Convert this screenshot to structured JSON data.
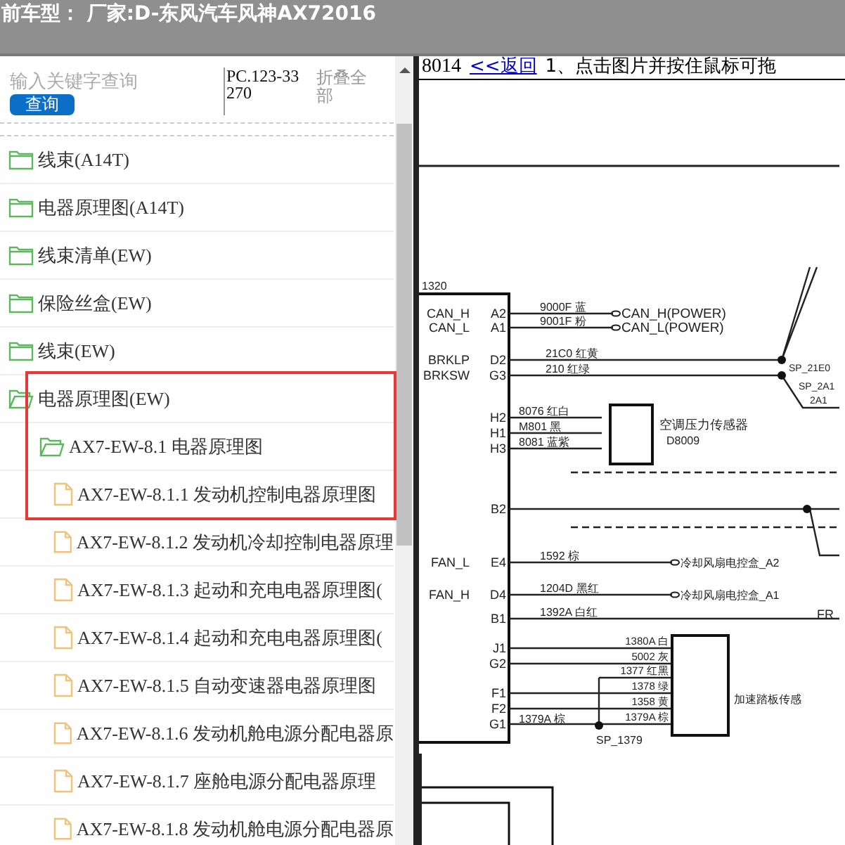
{
  "header": {
    "title": "前车型： 厂家:D-东风汽车风神AX72016"
  },
  "sidebar": {
    "search": {
      "placeholder": "输入关键字查询",
      "button": "查询"
    },
    "code": "PC.123-33270",
    "collapse_all": "折叠全部",
    "items": [
      {
        "kind": "folder",
        "label": "线束(A14T)",
        "expanded": false,
        "highlighted": false
      },
      {
        "kind": "folder",
        "label": "电器原理图(A14T)",
        "expanded": false,
        "highlighted": false
      },
      {
        "kind": "folder",
        "label": "线束清单(EW)",
        "expanded": false,
        "highlighted": false
      },
      {
        "kind": "folder",
        "label": "保险丝盒(EW)",
        "expanded": false,
        "highlighted": false
      },
      {
        "kind": "folder",
        "label": "线束(EW)",
        "expanded": false,
        "highlighted": false
      },
      {
        "kind": "folder",
        "label": "电器原理图(EW)",
        "expanded": true,
        "highlighted": true,
        "children": [
          {
            "kind": "folder",
            "label": "AX7-EW-8.1 电器原理图",
            "expanded": true,
            "highlighted": true,
            "children": [
              {
                "kind": "file",
                "label": "AX7-EW-8.1.1 发动机控制电器原理图",
                "highlighted": true
              },
              {
                "kind": "file",
                "label": "AX7-EW-8.1.2 发动机冷却控制电器原理",
                "highlighted": false
              },
              {
                "kind": "file",
                "label": "AX7-EW-8.1.3 起动和充电电器原理图(",
                "highlighted": false
              },
              {
                "kind": "file",
                "label": "AX7-EW-8.1.4 起动和充电电器原理图(",
                "highlighted": false
              },
              {
                "kind": "file",
                "label": "AX7-EW-8.1.5 自动变速器电器原理图",
                "highlighted": false
              },
              {
                "kind": "file",
                "label": "AX7-EW-8.1.6 发动机舱电源分配电器原",
                "highlighted": false
              },
              {
                "kind": "file",
                "label": "AX7-EW-8.1.7 座舱电源分配电器原理",
                "highlighted": false
              },
              {
                "kind": "file",
                "label": "AX7-EW-8.1.8 发动机舱电源分配电器原",
                "highlighted": false
              }
            ]
          }
        ]
      }
    ]
  },
  "viewer": {
    "page_code": "8014",
    "back_link": "<<返回",
    "hint": "1、点击图片并按住鼠标可拖",
    "diagram": {
      "connector": "1320",
      "pins": [
        {
          "signal": "CAN_H",
          "pin": "A2",
          "wire": "9000F 蓝",
          "target": "CAN_H(POWER)"
        },
        {
          "signal": "CAN_L",
          "pin": "A1",
          "wire": "9001F 粉",
          "target": "CAN_L(POWER)"
        },
        {
          "signal": "BRKLP",
          "pin": "D2",
          "wire": "21C0 红黄"
        },
        {
          "signal": "BRKSW",
          "pin": "G3",
          "wire": "210 红绿"
        },
        {
          "pin": "H2",
          "wire": "8076 红白"
        },
        {
          "pin": "H1",
          "wire": "M801 黑"
        },
        {
          "pin": "H3",
          "wire": "8081 蓝紫"
        },
        {
          "pin": "B2"
        },
        {
          "signal": "FAN_L",
          "pin": "E4",
          "wire": "1592 棕",
          "target": "冷却风扇电控盒_A2"
        },
        {
          "signal": "FAN_H",
          "pin": "D4",
          "wire": "1204D 黑红",
          "target": "冷却风扇电控盒_A1"
        },
        {
          "pin": "B1",
          "wire": "1392A 白红"
        },
        {
          "pin": "J1",
          "wire": "1380A 白"
        },
        {
          "pin": "G2",
          "wire": "5002 灰"
        },
        {
          "wire": "1377 红黑"
        },
        {
          "pin": "F1",
          "wire": "1378 绿"
        },
        {
          "pin": "F2",
          "wire": "1358 黄"
        },
        {
          "pin": "G1",
          "wire": "1379A 棕"
        }
      ],
      "labels": [
        "空调压力传感器",
        "D8009",
        "SP_1379",
        "加速踏板传感",
        "SP_21E0",
        "SP_2A1",
        "2A1",
        "1379A 棕",
        "FR"
      ]
    }
  }
}
